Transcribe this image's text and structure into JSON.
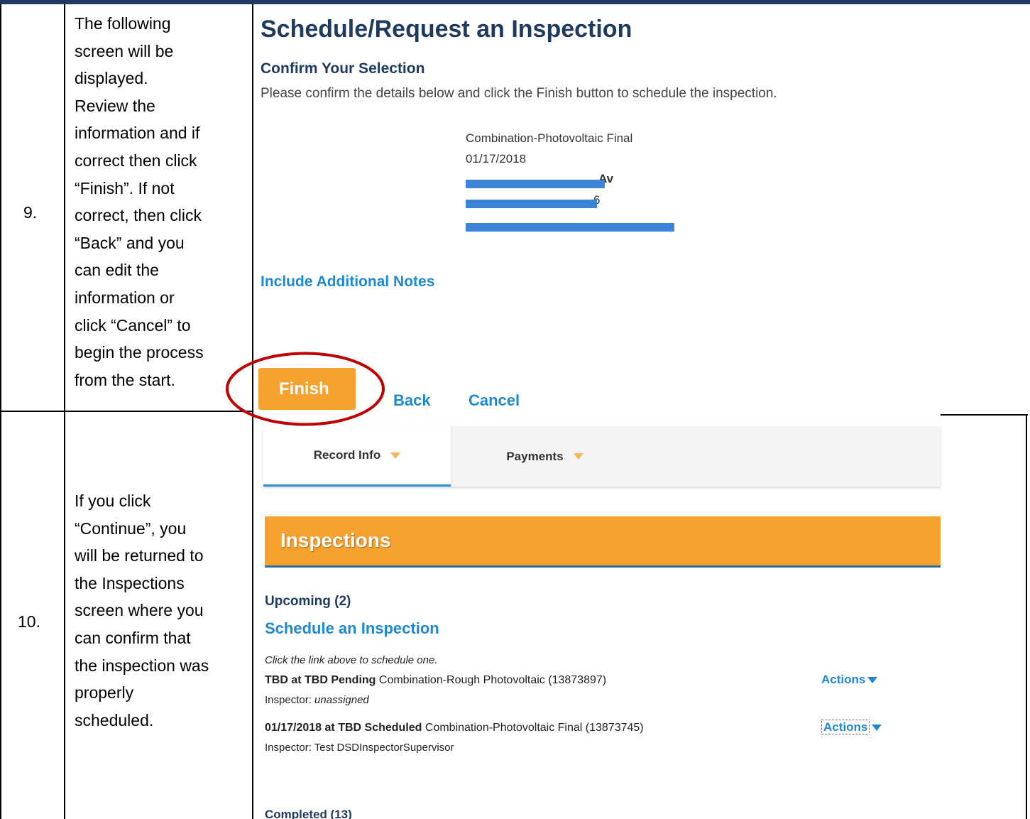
{
  "steps": [
    {
      "number": "9.",
      "lines": [
        "The following",
        "screen will be",
        "displayed.",
        "Review the",
        "information and if",
        "correct then click",
        "“Finish”.   If not",
        "correct, then click",
        "“Back” and you",
        "can edit the",
        "information or",
        "click “Cancel” to",
        "begin the process",
        "from the start."
      ]
    },
    {
      "number": "10.",
      "lines": [
        "If you click",
        "“Continue”, you",
        "will be returned to",
        "the Inspections",
        "screen where you",
        "can confirm that",
        "the inspection was",
        "properly",
        "scheduled."
      ]
    }
  ],
  "confirm_screen": {
    "title": "Schedule/Request an Inspection",
    "subtitle": "Confirm Your Selection",
    "description": "Please confirm the details below and click the Finish button to schedule the inspection.",
    "details": {
      "inspection_type": "Combination-Photovoltaic Final",
      "date": "01/17/2018",
      "address_partial": "Av",
      "zip_partial": "6"
    },
    "notes_link": "Include Additional Notes",
    "buttons": {
      "finish": "Finish",
      "back": "Back",
      "cancel": "Cancel"
    },
    "colors": {
      "accent": "#f7a12e",
      "link": "#1e88d4",
      "highlight": "#c00000",
      "redaction": "#3b84d8"
    }
  },
  "inspections_screen": {
    "tabs": [
      {
        "label": "Record Info"
      },
      {
        "label": "Payments"
      }
    ],
    "header": "Inspections",
    "upcoming_label": "Upcoming (2)",
    "schedule_link": "Schedule an Inspection",
    "hint": "Click the link above to schedule one.",
    "rows": [
      {
        "status_bold": "TBD at TBD Pending",
        "description": "Combination-Rough Photovoltaic (13873897)",
        "inspector_prefix": "Inspector: ",
        "inspector": "unassigned",
        "actions": "Actions"
      },
      {
        "status_bold": "01/17/2018 at TBD Scheduled",
        "description": "Combination-Photovoltaic Final (13873745)",
        "inspector_prefix": "Inspector: ",
        "inspector": "Test DSDInspectorSupervisor",
        "actions": "Actions"
      }
    ],
    "completed_label": "Completed (13)"
  }
}
